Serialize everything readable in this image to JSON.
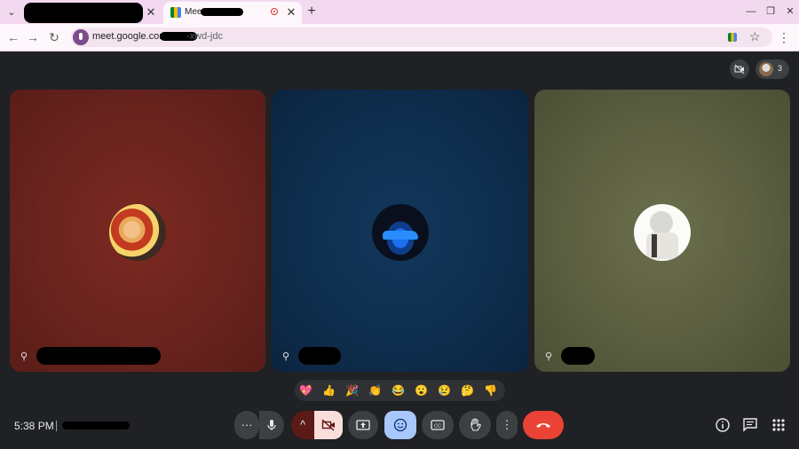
{
  "browser": {
    "tabs": [
      {
        "title": "",
        "redacted": true
      },
      {
        "title": "Meet - ",
        "redacted_suffix": true,
        "recording": true,
        "active": true
      }
    ],
    "new_tab_label": "+",
    "address": {
      "url_prefix": "meet.google.com/",
      "url_suffix": "-xwd-jdc"
    },
    "window_controls": [
      "minimize-icon",
      "restore-icon",
      "close-icon"
    ]
  },
  "meet": {
    "participant_count": "3",
    "tiles": [
      {
        "background": "#6a231d",
        "avatar_icon": "anime-avatar",
        "name_redacted": true,
        "pin_icon": "pin-icon"
      },
      {
        "background": "#0e2e4e",
        "avatar_icon": "blue-car-avatar",
        "name_redacted": true,
        "pin_icon": "pin-icon"
      },
      {
        "background": "#5b5f40",
        "avatar_icon": "white-hair-character-avatar",
        "name_redacted": true,
        "pin_icon": "pin-icon"
      }
    ],
    "reactions": [
      "💖",
      "👍",
      "🎉",
      "👏",
      "😂",
      "😮",
      "😢",
      "🤔",
      "👎"
    ],
    "bottom": {
      "time": "5:38 PM",
      "separator": "|",
      "controls": [
        {
          "name": "more-audio-button",
          "label": "···"
        },
        {
          "name": "mic-button",
          "icon": "mic-icon"
        },
        {
          "name": "video-options-button",
          "label": "^"
        },
        {
          "name": "camera-off-button",
          "icon": "video-off-icon"
        },
        {
          "name": "present-button",
          "icon": "present-screen-icon"
        },
        {
          "name": "reactions-button",
          "icon": "emoji-icon"
        },
        {
          "name": "captions-button",
          "icon": "captions-icon"
        },
        {
          "name": "raise-hand-button",
          "icon": "hand-icon"
        },
        {
          "name": "more-options-button",
          "label": "⋮"
        },
        {
          "name": "leave-call-button",
          "icon": "end-call-icon"
        }
      ],
      "right_icons": [
        "info-icon",
        "chat-icon",
        "activities-icon"
      ]
    },
    "colors": {
      "leave": "#ea4335",
      "active_reaction": "#a8c7fa",
      "camera_off": "#f9dedc",
      "accent": "#8ab4f8"
    }
  }
}
